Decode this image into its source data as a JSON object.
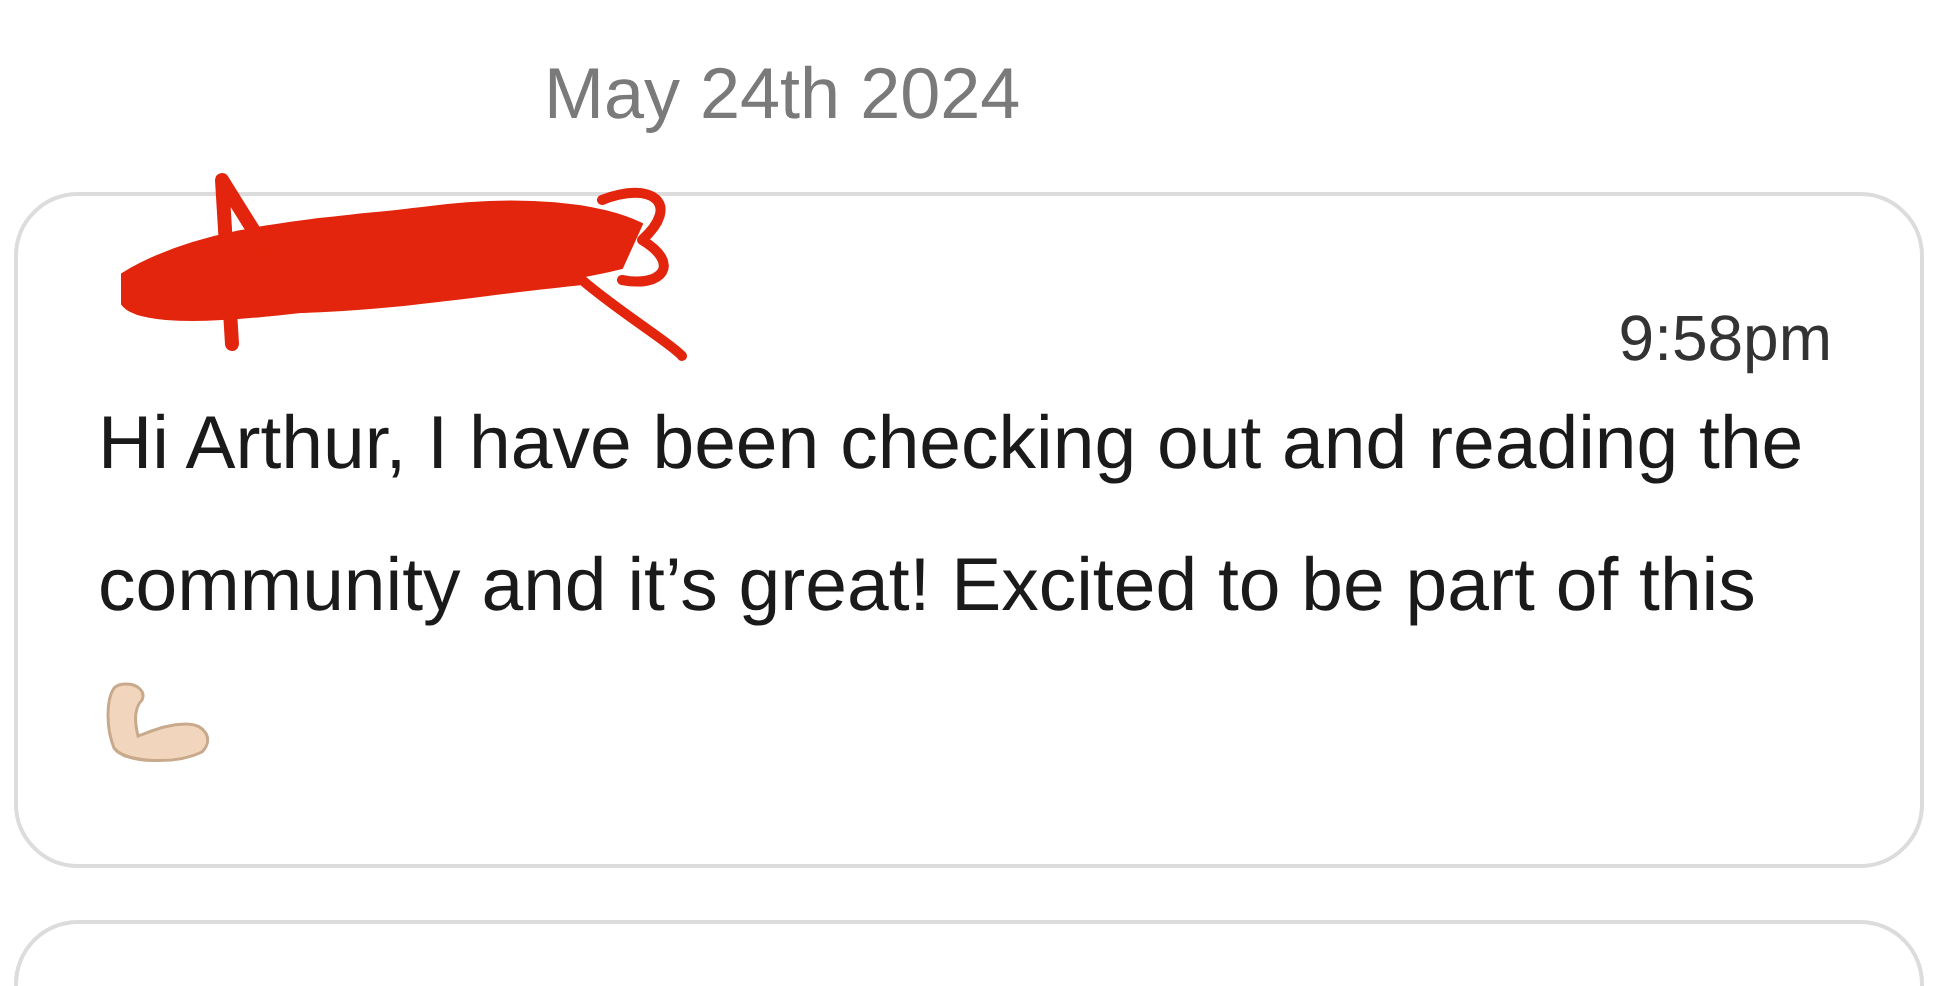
{
  "date_header": "May 24th 2024",
  "message": {
    "time": "9:58pm",
    "text": "Hi Arthur, I have been checking out and reading the community and it’s great! Excited to be part of this"
  }
}
